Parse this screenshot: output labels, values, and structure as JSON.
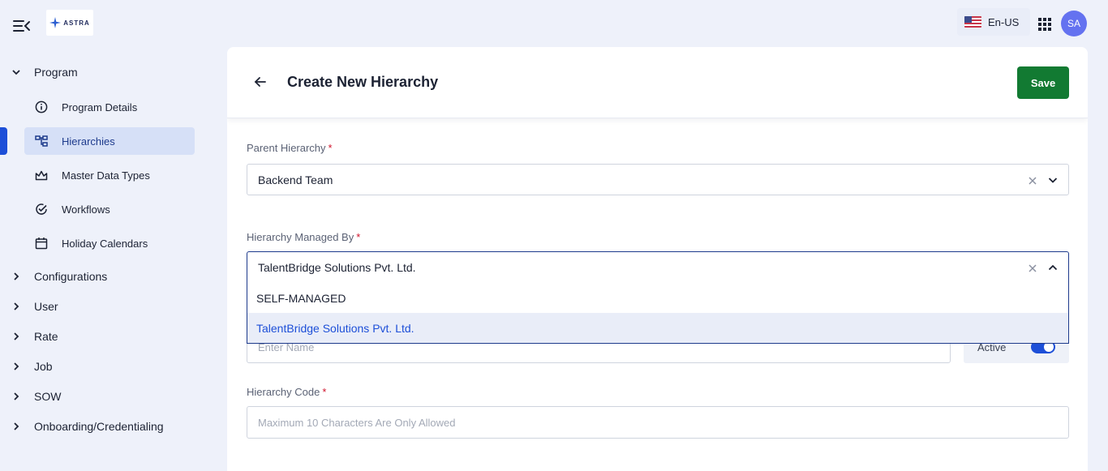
{
  "header": {
    "logo_text": "ASTRA",
    "language": "En-US",
    "avatar_initials": "SA"
  },
  "sidebar": {
    "sections": [
      {
        "label": "Program",
        "expanded": true
      },
      {
        "label": "Configurations",
        "expanded": false
      },
      {
        "label": "User",
        "expanded": false
      },
      {
        "label": "Rate",
        "expanded": false
      },
      {
        "label": "Job",
        "expanded": false
      },
      {
        "label": "SOW",
        "expanded": false
      },
      {
        "label": "Onboarding/Credentialing",
        "expanded": false
      }
    ],
    "program_items": [
      {
        "label": "Program Details",
        "icon": "info-icon"
      },
      {
        "label": "Hierarchies",
        "icon": "hierarchy-icon",
        "active": true
      },
      {
        "label": "Master Data Types",
        "icon": "master-data-icon"
      },
      {
        "label": "Workflows",
        "icon": "check-circle-icon"
      },
      {
        "label": "Holiday Calendars",
        "icon": "calendar-icon"
      }
    ]
  },
  "main": {
    "title": "Create New Hierarchy",
    "save_label": "Save",
    "parent_hierarchy": {
      "label": "Parent Hierarchy",
      "required": "*",
      "value": "Backend Team"
    },
    "managed_by": {
      "label": "Hierarchy Managed By",
      "required": "*",
      "value": "TalentBridge Solutions Pvt. Ltd.",
      "options": [
        "SELF-MANAGED",
        "TalentBridge Solutions Pvt. Ltd."
      ],
      "selected_index": 1
    },
    "name": {
      "placeholder": "Enter Name"
    },
    "status": {
      "label": "Active",
      "on": true
    },
    "hierarchy_code": {
      "label": "Hierarchy Code",
      "required": "*",
      "placeholder": "Maximum 10 Characters Are Only Allowed"
    }
  },
  "colors": {
    "accent": "#1d4fd8",
    "save_button": "#127a32",
    "background": "#eef1fa",
    "required": "#d0142c"
  }
}
